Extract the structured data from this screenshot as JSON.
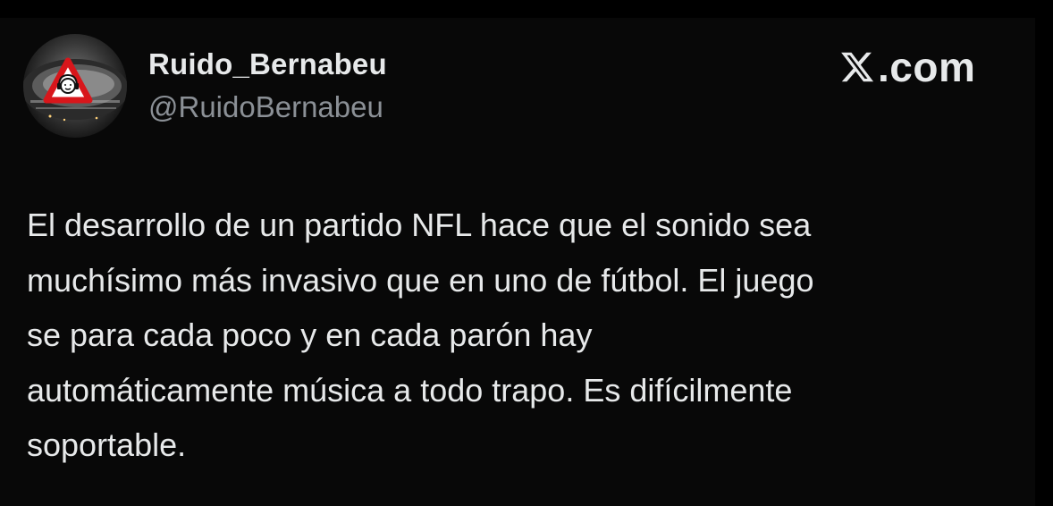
{
  "author": {
    "display_name": "Ruido_Bernabeu",
    "handle": "@RuidoBernabeu",
    "avatar_icon": "stadium-warning-sign-avatar"
  },
  "brand": {
    "icon": "x-logo-icon",
    "text": ".com"
  },
  "tweet": {
    "lines": [
      "El desarrollo de un partido NFL hace que el sonido sea",
      "muchísimo más invasivo que en uno de fútbol. El juego",
      "se para cada poco y en cada parón hay",
      "automáticamente música a todo trapo. Es difícilmente",
      "soportable."
    ]
  },
  "colors": {
    "background": "#000000",
    "card": "#080808",
    "primary_text": "#e7e9ea",
    "secondary_text": "#8b9096",
    "warning_red": "#d8161b"
  }
}
